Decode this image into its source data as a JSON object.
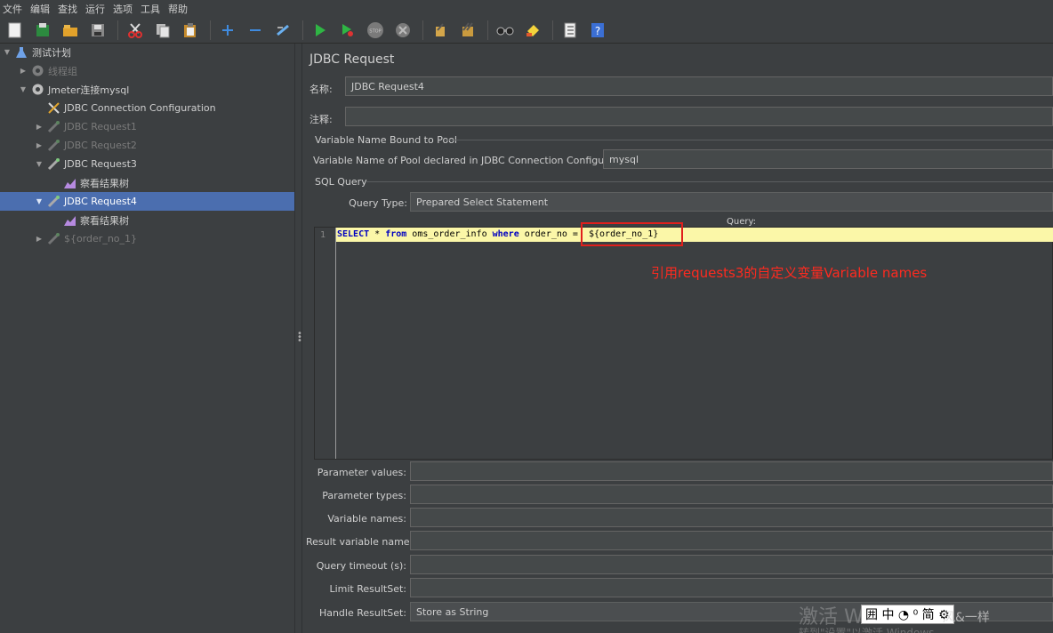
{
  "menu": [
    "文件",
    "编辑",
    "查找",
    "运行",
    "选项",
    "工具",
    "帮助"
  ],
  "toolbar_icons": [
    "new-icon",
    "templates-icon",
    "open-icon",
    "save-icon",
    "cut-icon",
    "copy-icon",
    "paste-icon",
    "expand-icon",
    "collapse-icon",
    "toggle-icon",
    "start-icon",
    "start-no-pause-icon",
    "stop-icon",
    "shutdown-icon",
    "clear-icon",
    "clear-all-icon",
    "search-icon",
    "reset-search-icon",
    "function-helper-icon",
    "help-icon"
  ],
  "tree": [
    {
      "label": "测试计划",
      "icon": "flask-icon",
      "depth": 0,
      "arrow": "▼",
      "state": "normal"
    },
    {
      "label": "线程组",
      "icon": "gear-icon",
      "depth": 1,
      "arrow": "▶",
      "state": "disabled"
    },
    {
      "label": "Jmeter连接mysql",
      "icon": "gear-icon",
      "depth": 1,
      "arrow": "▼",
      "state": "normal"
    },
    {
      "label": "JDBC Connection Configuration",
      "icon": "wrench-icon",
      "depth": 2,
      "arrow": "",
      "state": "normal"
    },
    {
      "label": "JDBC Request1",
      "icon": "pipette-icon",
      "depth": 2,
      "arrow": "▶",
      "state": "disabled"
    },
    {
      "label": "JDBC Request2",
      "icon": "pipette-icon",
      "depth": 2,
      "arrow": "▶",
      "state": "disabled"
    },
    {
      "label": "JDBC Request3",
      "icon": "pipette-icon",
      "depth": 2,
      "arrow": "▼",
      "state": "normal"
    },
    {
      "label": "察看结果树",
      "icon": "chart-icon",
      "depth": 3,
      "arrow": "",
      "state": "normal"
    },
    {
      "label": "JDBC Request4",
      "icon": "pipette-icon",
      "depth": 2,
      "arrow": "▼",
      "state": "selected"
    },
    {
      "label": "察看结果树",
      "icon": "chart-icon",
      "depth": 3,
      "arrow": "",
      "state": "normal"
    },
    {
      "label": "${order_no_1}",
      "icon": "pipette-icon",
      "depth": 2,
      "arrow": "▶",
      "state": "disabled"
    }
  ],
  "panel": {
    "title": "JDBC Request",
    "name_label": "名称:",
    "name_value": "JDBC Request4",
    "comment_label": "注释:",
    "comment_value": "",
    "pool_section": "Variable Name Bound to Pool",
    "pool_label": "Variable Name of Pool declared in JDBC Connection Configuration:",
    "pool_value": "mysql",
    "sql_section": "SQL Query",
    "query_type_label": "Query Type:",
    "query_type_value": "Prepared Select Statement",
    "query_label": "Query:",
    "line_number": "1",
    "params": [
      {
        "label": "Parameter values:",
        "value": ""
      },
      {
        "label": "Parameter types:",
        "value": ""
      },
      {
        "label": "Variable names:",
        "value": ""
      },
      {
        "label": "Result variable name:",
        "value": ""
      },
      {
        "label": "Query timeout (s):",
        "value": ""
      },
      {
        "label": "Limit ResultSet:",
        "value": ""
      },
      {
        "label": "Handle ResultSet:",
        "value": "Store as String"
      }
    ]
  },
  "sql": {
    "kw_select": "SELECT",
    "star": " * ",
    "kw_from": "from",
    "table": " oms_order_info ",
    "kw_where": "where",
    "cond": " order_no = ",
    "var": " ${order_no_1}"
  },
  "annotation": "引用requests3的自定义变量Variable names",
  "watermark": {
    "line1": "激活 Wi",
    "line2": "转到\"设置\"以激活 Windows",
    "ime": "囲 中 ◔ ⁰ 简 ⚙",
    "csdn": "风&一样"
  }
}
